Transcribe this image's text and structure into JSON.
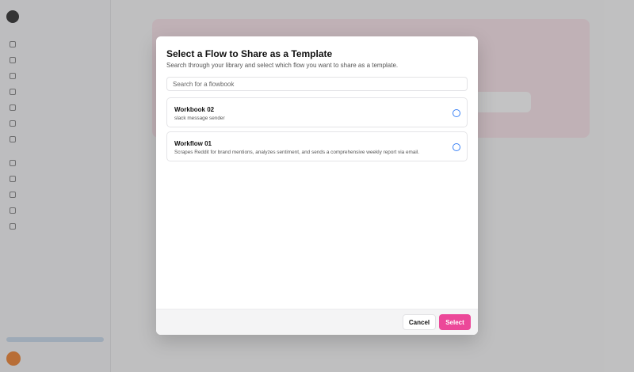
{
  "modal": {
    "title": "Select a Flow to Share as a Template",
    "subtitle": "Search through your library and select which flow you want to share as a template.",
    "search_placeholder": "Search for a flowbook",
    "flows": [
      {
        "name": "Workbook 02",
        "description": "slack message sender",
        "selected": false
      },
      {
        "name": "Workflow 01",
        "description": "Scrapes Reddit for brand mentions, analyzes sentiment, and sends a comprehensive weekly report via email.",
        "selected": false
      }
    ],
    "cancel_label": "Cancel",
    "select_label": "Select"
  },
  "colors": {
    "accent": "#ec4899",
    "radio": "#3b82f6"
  },
  "icons": {
    "radio": "radio-unchecked-icon"
  }
}
